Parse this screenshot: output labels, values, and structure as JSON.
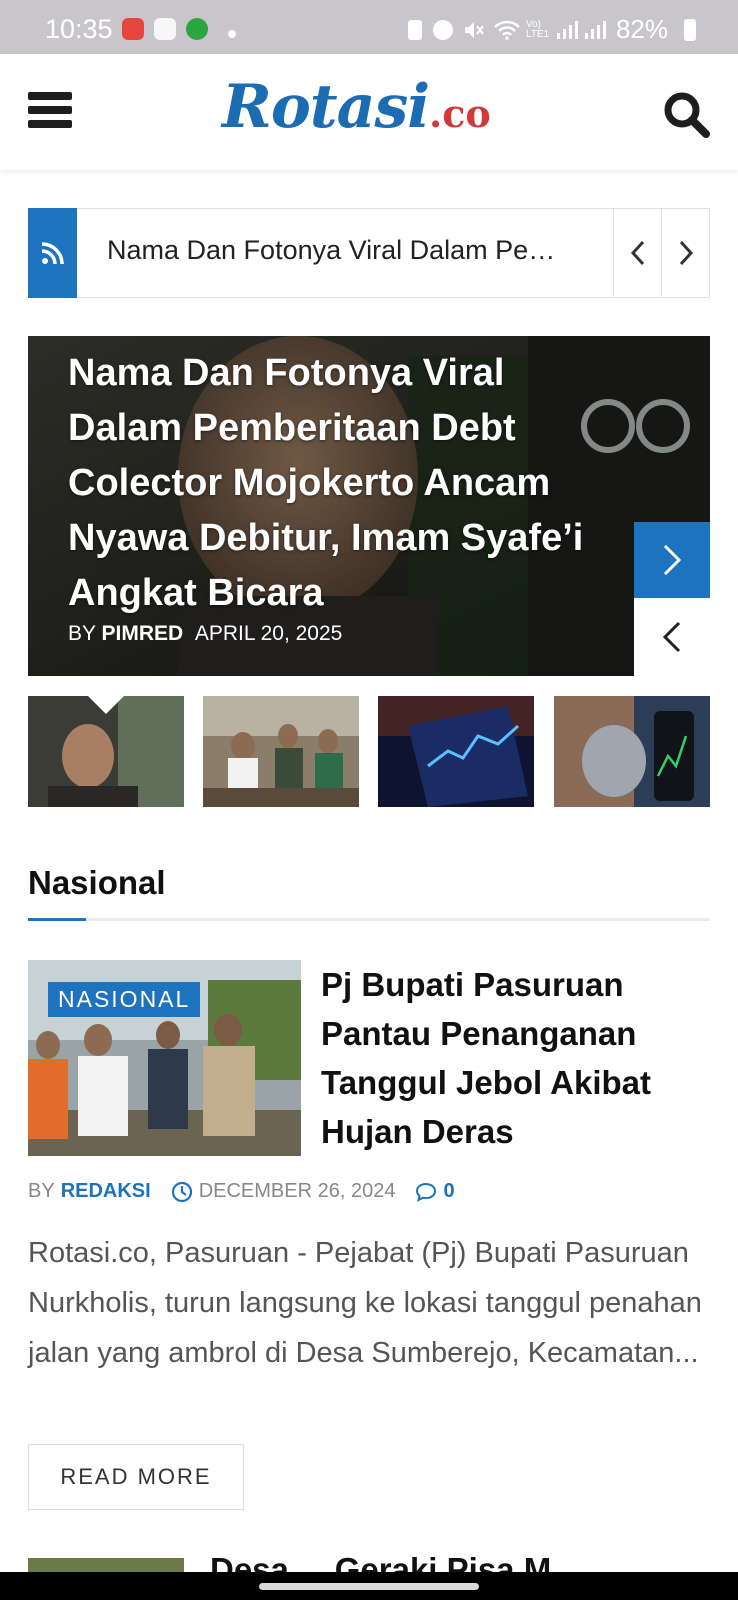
{
  "status_bar": {
    "time": "10:35",
    "battery": "82%"
  },
  "header": {
    "logo_main": "Rotasi",
    "logo_tld": ".co",
    "menu_icon": "hamburger-icon",
    "search_icon": "search-icon"
  },
  "ticker": {
    "text": "Nama Dan Fotonya Viral Dalam Pemberitaan Debt Colector Mojokerto Ancam Nyawa Debitur, Imam Syafe’i Angkat Bicara",
    "icon": "rss-icon"
  },
  "featured": {
    "headline": "Nama Dan Fotonya Viral Dalam Pemberitaan Debt Colector Mojokerto Ancam Nyawa Debitur, Imam Syafe’i Angkat Bicara",
    "by_label": "BY",
    "author": "PIMRED",
    "date": "APRIL 20, 2025"
  },
  "section": {
    "title": "Nasional"
  },
  "article": {
    "badge": "NASIONAL",
    "title": "Pj Bupati Pasuruan Pantau Penanganan Tanggul Jebol Akibat Hujan Deras",
    "by_label": "BY",
    "author": "REDAKSI",
    "date": "DECEMBER 26, 2024",
    "comments": "0",
    "excerpt": "Rotasi.co, Pasuruan - Pejabat (Pj) Bupati Pasuruan Nurkholis, turun langsung ke lokasi tanggul penahan jalan yang ambrol di Desa Sumberejo, Kecamatan...",
    "read_more": "READ MORE"
  },
  "next_article": {
    "title_fragment": "Desa ... Geraki Pisa M..."
  },
  "colors": {
    "accent": "#1e73be",
    "logo_blue": "#1b6cb3",
    "logo_red": "#d23a3a"
  }
}
